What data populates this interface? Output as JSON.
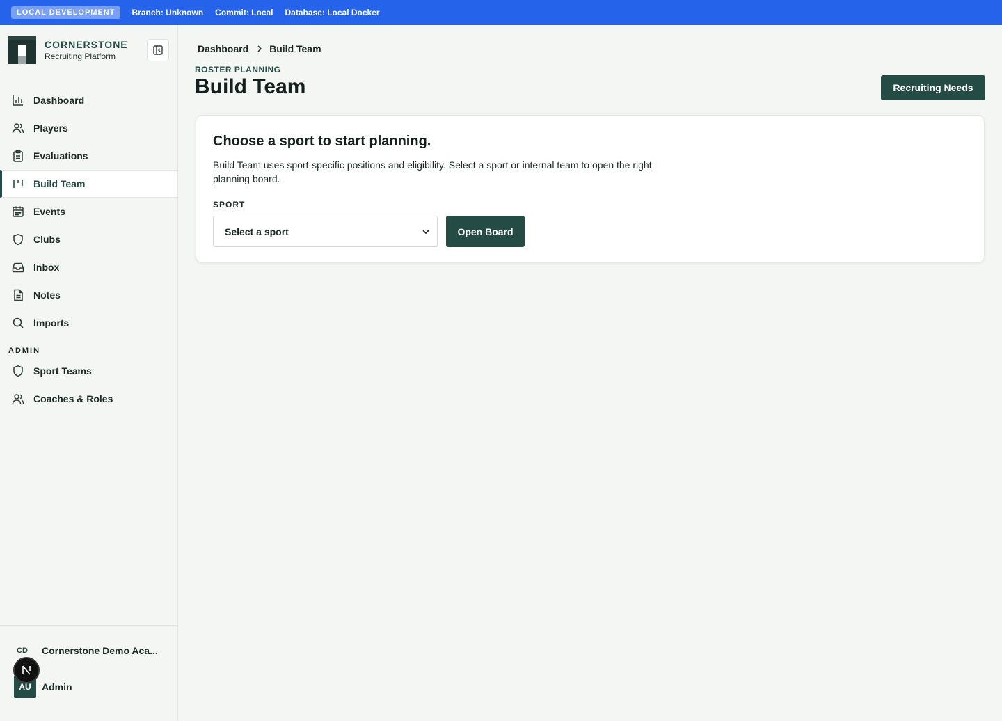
{
  "devbar": {
    "badge": "LOCAL DEVELOPMENT",
    "branch": "Branch: Unknown",
    "commit": "Commit: Local",
    "database": "Database: Local Docker"
  },
  "brand": {
    "name": "CORNERSTONE",
    "subtitle": "Recruiting Platform"
  },
  "nav": {
    "items": [
      {
        "label": "Dashboard",
        "icon": "bar-chart-icon"
      },
      {
        "label": "Players",
        "icon": "users-icon"
      },
      {
        "label": "Evaluations",
        "icon": "clipboard-icon"
      },
      {
        "label": "Build Team",
        "icon": "columns-icon",
        "active": true
      },
      {
        "label": "Events",
        "icon": "calendar-icon"
      },
      {
        "label": "Clubs",
        "icon": "shield-icon"
      },
      {
        "label": "Inbox",
        "icon": "inbox-icon"
      },
      {
        "label": "Notes",
        "icon": "document-icon"
      },
      {
        "label": "Imports",
        "icon": "search-icon"
      }
    ],
    "admin_label": "ADMIN",
    "admin_items": [
      {
        "label": "Sport Teams",
        "icon": "shield-icon"
      },
      {
        "label": "Coaches & Roles",
        "icon": "users-icon"
      }
    ]
  },
  "footer": {
    "org_initials": "CD",
    "org_name": "Cornerstone Demo Aca...",
    "user_initials": "AU",
    "user_name": "Admin",
    "next_badge": "N"
  },
  "main": {
    "breadcrumb": [
      "Dashboard",
      "Build Team"
    ],
    "eyebrow": "ROSTER PLANNING",
    "title": "Build Team",
    "primary_button": "Recruiting Needs",
    "card": {
      "title": "Choose a sport to start planning.",
      "description": "Build Team uses sport-specific positions and eligibility. Select a sport or internal team to open the right planning board.",
      "field_label": "SPORT",
      "select_value": "Select a sport",
      "open_button": "Open Board"
    }
  },
  "colors": {
    "banner": "#2563eb",
    "accent": "#244c44",
    "background": "#f4f6f3"
  }
}
